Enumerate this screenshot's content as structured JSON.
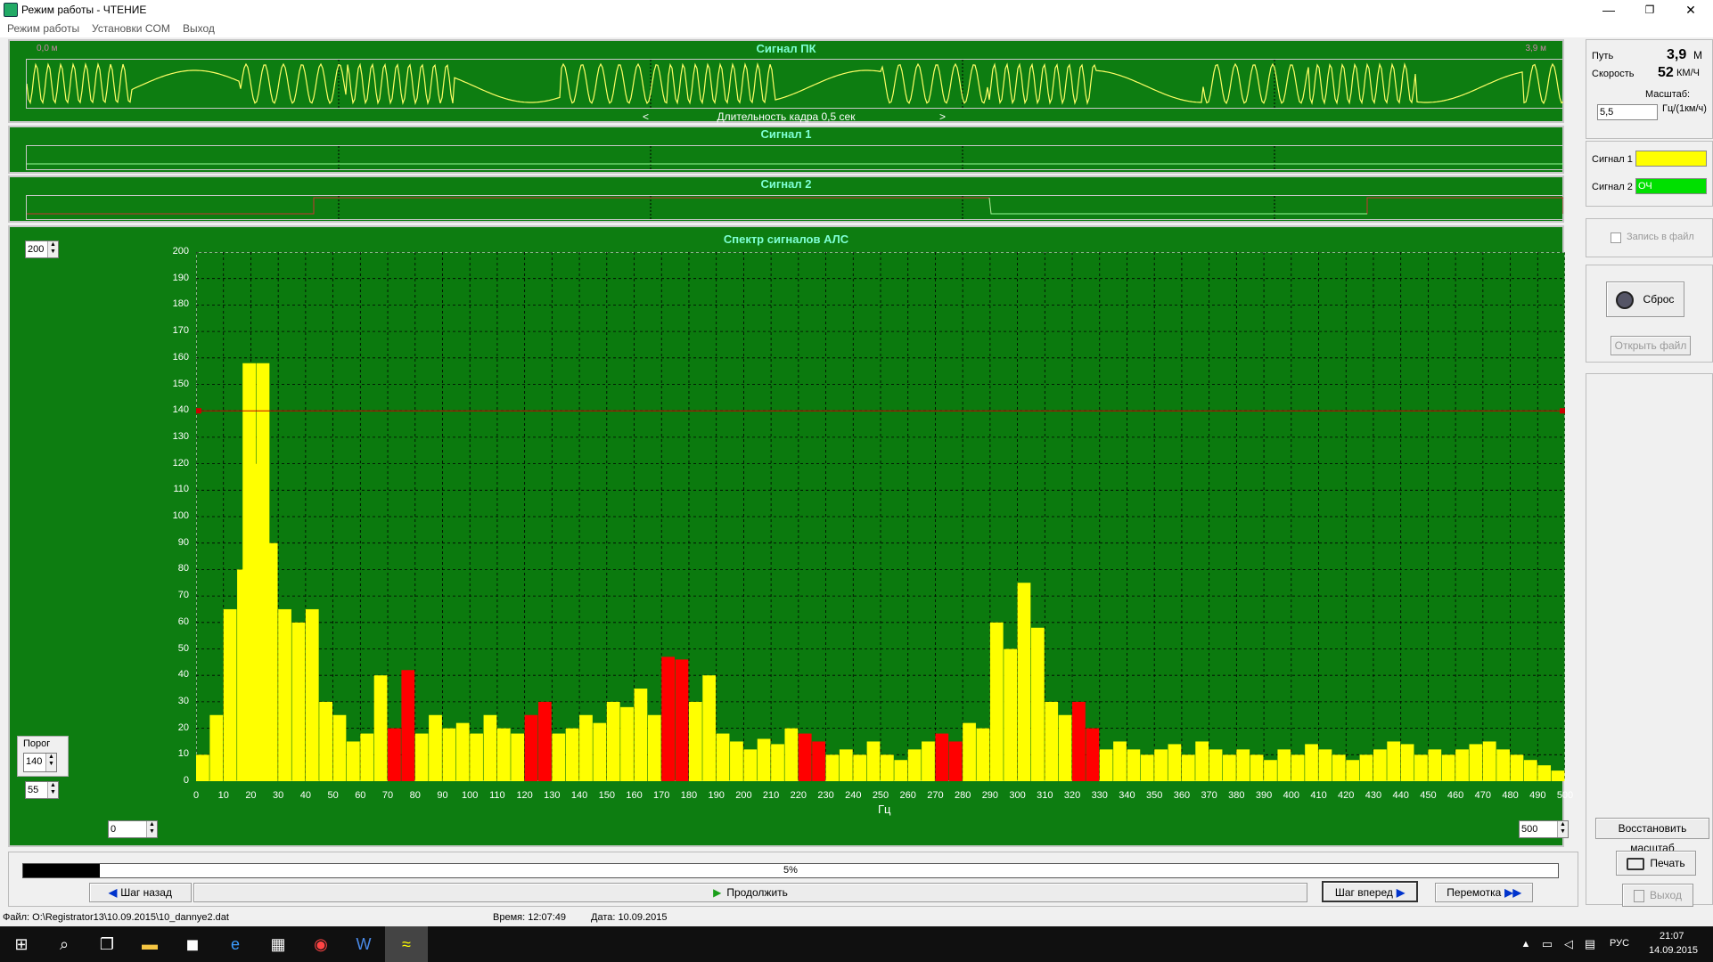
{
  "window": {
    "title": "Режим работы - ЧТЕНИЕ",
    "minimize": "—",
    "maximize": "❐",
    "close": "✕"
  },
  "menu": [
    "Режим работы",
    "Установки COM",
    "Выход"
  ],
  "signal_pk": {
    "title": "Сигнал ПК",
    "start_label": "0,0 м",
    "end_label": "3,9 м",
    "frame_label": "Длительность кадра 0,5 сек",
    "prev": "<",
    "next": ">"
  },
  "signal1": {
    "title": "Сигнал 1"
  },
  "signal2": {
    "title": "Сигнал 2"
  },
  "info": {
    "path_label": "Путь",
    "path_value": "3,9",
    "path_unit": "М",
    "speed_label": "Скорость",
    "speed_value": "52",
    "speed_unit": "КМ/Ч",
    "scale_label": "Масштаб:",
    "scale_value": "5,5",
    "scale_unit": "Гц/(1км/ч)"
  },
  "legend": {
    "sig1_label": "Сигнал 1",
    "sig1_value": "",
    "sig1_color": "#ffff00",
    "sig2_label": "Сигнал 2",
    "sig2_value": "ОЧ",
    "sig2_color": "#00e000"
  },
  "record": {
    "label": "Запись в файл",
    "checked": false
  },
  "buttons": {
    "reset": "Сброс",
    "open_file": "Открыть файл",
    "restore_scale": "Восстановить масштаб",
    "print": "Печать",
    "exit": "Выход",
    "step_back": "Шаг назад",
    "continue": "Продолжить",
    "step_forward": "Шаг вперед",
    "rewind": "Перемотка"
  },
  "spectrum": {
    "title": "Спектр сигналов АЛС",
    "ymax_value": "200",
    "threshold_label": "Порог",
    "threshold_value": "140",
    "low_value": "55",
    "xmin_value": "0",
    "xmax_value": "500",
    "xunit": "Гц"
  },
  "progress": {
    "label": "5%",
    "percent": 5
  },
  "status": {
    "file": "Файл: O:\\Registrator13\\10.09.2015\\10_dannye2.dat",
    "time": "Время: 12:07:49",
    "date": "Дата: 10.09.2015"
  },
  "taskbar": {
    "lang": "РУС",
    "time": "21:07",
    "date": "14.09.2015"
  },
  "chart_data": {
    "type": "bar",
    "title": "Спектр сигналов АЛС",
    "xlabel": "Гц",
    "xlim": [
      0,
      500
    ],
    "ylim": [
      0,
      200
    ],
    "xticks": [
      0,
      10,
      20,
      30,
      40,
      50,
      60,
      70,
      80,
      90,
      100,
      110,
      120,
      130,
      140,
      150,
      160,
      170,
      180,
      190,
      200,
      210,
      220,
      230,
      240,
      250,
      260,
      270,
      280,
      290,
      300,
      310,
      320,
      330,
      340,
      350,
      360,
      370,
      380,
      390,
      400,
      410,
      420,
      430,
      440,
      450,
      460,
      470,
      480,
      490,
      500
    ],
    "yticks": [
      0,
      10,
      20,
      30,
      40,
      50,
      60,
      70,
      80,
      90,
      100,
      110,
      120,
      130,
      140,
      150,
      160,
      170,
      180,
      190,
      200
    ],
    "threshold": 140,
    "series_colors": {
      "normal": "#ffff00",
      "band": "#ff0000"
    },
    "red_bands": [
      [
        70,
        80
      ],
      [
        120,
        130
      ],
      [
        170,
        180
      ],
      [
        220,
        230
      ],
      [
        270,
        280
      ],
      [
        320,
        330
      ]
    ],
    "x": [
      0,
      5,
      10,
      15,
      17,
      20,
      22,
      25,
      30,
      35,
      40,
      45,
      50,
      55,
      60,
      65,
      70,
      75,
      80,
      85,
      90,
      95,
      100,
      105,
      110,
      115,
      120,
      125,
      130,
      135,
      140,
      145,
      150,
      155,
      160,
      165,
      170,
      175,
      180,
      185,
      190,
      195,
      200,
      205,
      210,
      215,
      220,
      225,
      230,
      235,
      240,
      245,
      250,
      255,
      260,
      265,
      270,
      275,
      280,
      285,
      290,
      295,
      300,
      305,
      310,
      315,
      320,
      325,
      330,
      335,
      340,
      345,
      350,
      355,
      360,
      365,
      370,
      375,
      380,
      385,
      390,
      395,
      400,
      405,
      410,
      415,
      420,
      425,
      430,
      435,
      440,
      445,
      450,
      455,
      460,
      465,
      470,
      475,
      480,
      485,
      490,
      495,
      500
    ],
    "values": [
      10,
      25,
      65,
      80,
      158,
      120,
      158,
      90,
      65,
      60,
      65,
      30,
      25,
      15,
      18,
      40,
      20,
      42,
      18,
      25,
      20,
      22,
      18,
      25,
      20,
      18,
      25,
      30,
      18,
      20,
      25,
      22,
      30,
      28,
      35,
      25,
      47,
      46,
      30,
      40,
      18,
      15,
      12,
      16,
      14,
      20,
      18,
      15,
      10,
      12,
      10,
      15,
      10,
      8,
      12,
      15,
      18,
      15,
      22,
      20,
      60,
      50,
      75,
      58,
      30,
      25,
      30,
      20,
      12,
      15,
      12,
      10,
      12,
      14,
      10,
      15,
      12,
      10,
      12,
      10,
      8,
      12,
      10,
      14,
      12,
      10,
      8,
      10,
      12,
      15,
      14,
      10,
      12,
      10,
      12,
      14,
      15,
      12,
      10,
      8,
      6,
      4,
      3
    ]
  }
}
